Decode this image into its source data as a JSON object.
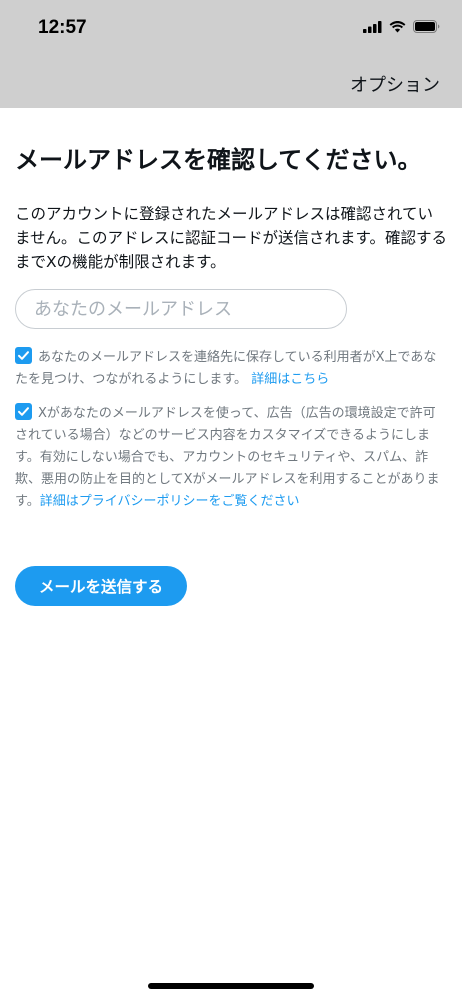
{
  "status_bar": {
    "time": "12:57"
  },
  "nav": {
    "options_label": "オプション"
  },
  "main": {
    "title": "メールアドレスを確認してください。",
    "description": "このアカウントに登録されたメールアドレスは確認されていません。このアドレスに認証コードが送信されます。確認するまでXの機能が制限されます。",
    "email_input": {
      "value": "",
      "placeholder": "あなたのメールアドレス"
    },
    "consent_contacts": {
      "checked": true,
      "text": "あなたのメールアドレスを連絡先に保存している利用者がX上であなたを見つけ、つながれるようにします。",
      "link_label": "詳細はこちら"
    },
    "consent_ads": {
      "checked": true,
      "text": "Xがあなたのメールアドレスを使って、広告（広告の環境設定で許可されている場合）などのサービス内容をカスタマイズできるようにします。有効にしない場合でも、アカウントのセキュリティや、スパム、詐欺、悪用の防止を目的としてXがメールアドレスを利用することがあります。",
      "link_label": "詳細はプライバシーポリシーをご覧ください"
    },
    "send_button_label": "メールを送信する"
  },
  "colors": {
    "accent": "#1d9bf0",
    "header_bg": "#cfcfcf",
    "secondary_text": "#70787f"
  }
}
